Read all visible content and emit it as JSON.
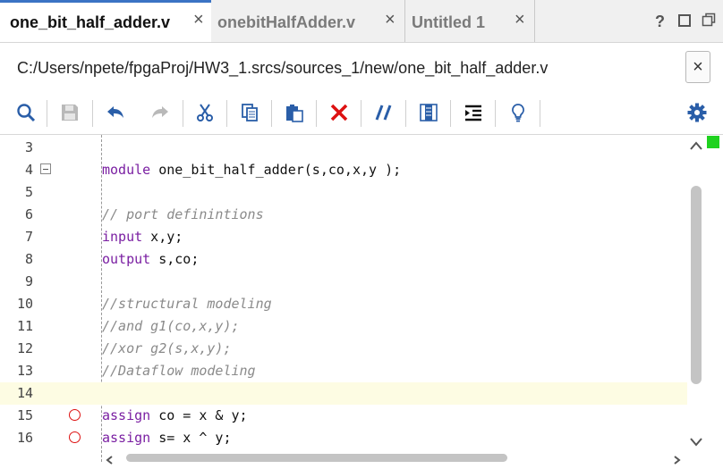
{
  "tabs": [
    {
      "label": "one_bit_half_adder.v",
      "close": "×",
      "active": true
    },
    {
      "label": "onebitHalfAdder.v",
      "close": "×",
      "active": false
    },
    {
      "label": "Untitled 1",
      "close": "×",
      "active": false
    }
  ],
  "window_icons": {
    "help": "?",
    "maximize": "□",
    "restore": "⧉"
  },
  "file_path": "C:/Users/npete/fpgaProj/HW3_1.srcs/sources_1/new/one_bit_half_adder.v",
  "path_close": "×",
  "toolbar_icons": [
    "search-icon",
    "save-icon",
    "undo-icon",
    "redo-icon",
    "cut-icon",
    "copy-icon",
    "paste-icon",
    "delete-icon",
    "comment-icon",
    "column-select-icon",
    "indent-icon",
    "bulb-icon",
    "gear-icon"
  ],
  "colors": {
    "keyword": "#7a1fa2",
    "comment": "#8a8a8a",
    "active_tab_border": "#3b73c4",
    "current_line": "#fdfce3",
    "breakpoint": "#dd1111",
    "status_ok": "#1fd21f"
  },
  "editor": {
    "lines": [
      {
        "num": "3",
        "kw": "",
        "rest": "",
        "comment": ""
      },
      {
        "num": "4",
        "kw": "module",
        "rest": " one_bit_half_adder(s,co,x,y );",
        "comment": "",
        "fold": true
      },
      {
        "num": "5",
        "kw": "",
        "rest": "",
        "comment": ""
      },
      {
        "num": "6",
        "kw": "",
        "rest": "",
        "comment": "// port definintions"
      },
      {
        "num": "7",
        "kw": "input",
        "rest": " x,y;",
        "comment": ""
      },
      {
        "num": "8",
        "kw": "output",
        "rest": " s,co;",
        "comment": ""
      },
      {
        "num": "9",
        "kw": "",
        "rest": "",
        "comment": ""
      },
      {
        "num": "10",
        "kw": "",
        "rest": "",
        "comment": "//structural modeling"
      },
      {
        "num": "11",
        "kw": "",
        "rest": "",
        "comment": "//and g1(co,x,y);"
      },
      {
        "num": "12",
        "kw": "",
        "rest": "",
        "comment": "//xor g2(s,x,y);"
      },
      {
        "num": "13",
        "kw": "",
        "rest": "",
        "comment": "//Dataflow modeling"
      },
      {
        "num": "14",
        "kw": "",
        "rest": "",
        "comment": "",
        "current": true
      },
      {
        "num": "15",
        "kw": "assign",
        "rest": " co = x & y;",
        "comment": "",
        "breakpoint": true
      },
      {
        "num": "16",
        "kw": "assign",
        "rest": " s= x ^ y;",
        "comment": "",
        "breakpoint": true
      }
    ]
  }
}
